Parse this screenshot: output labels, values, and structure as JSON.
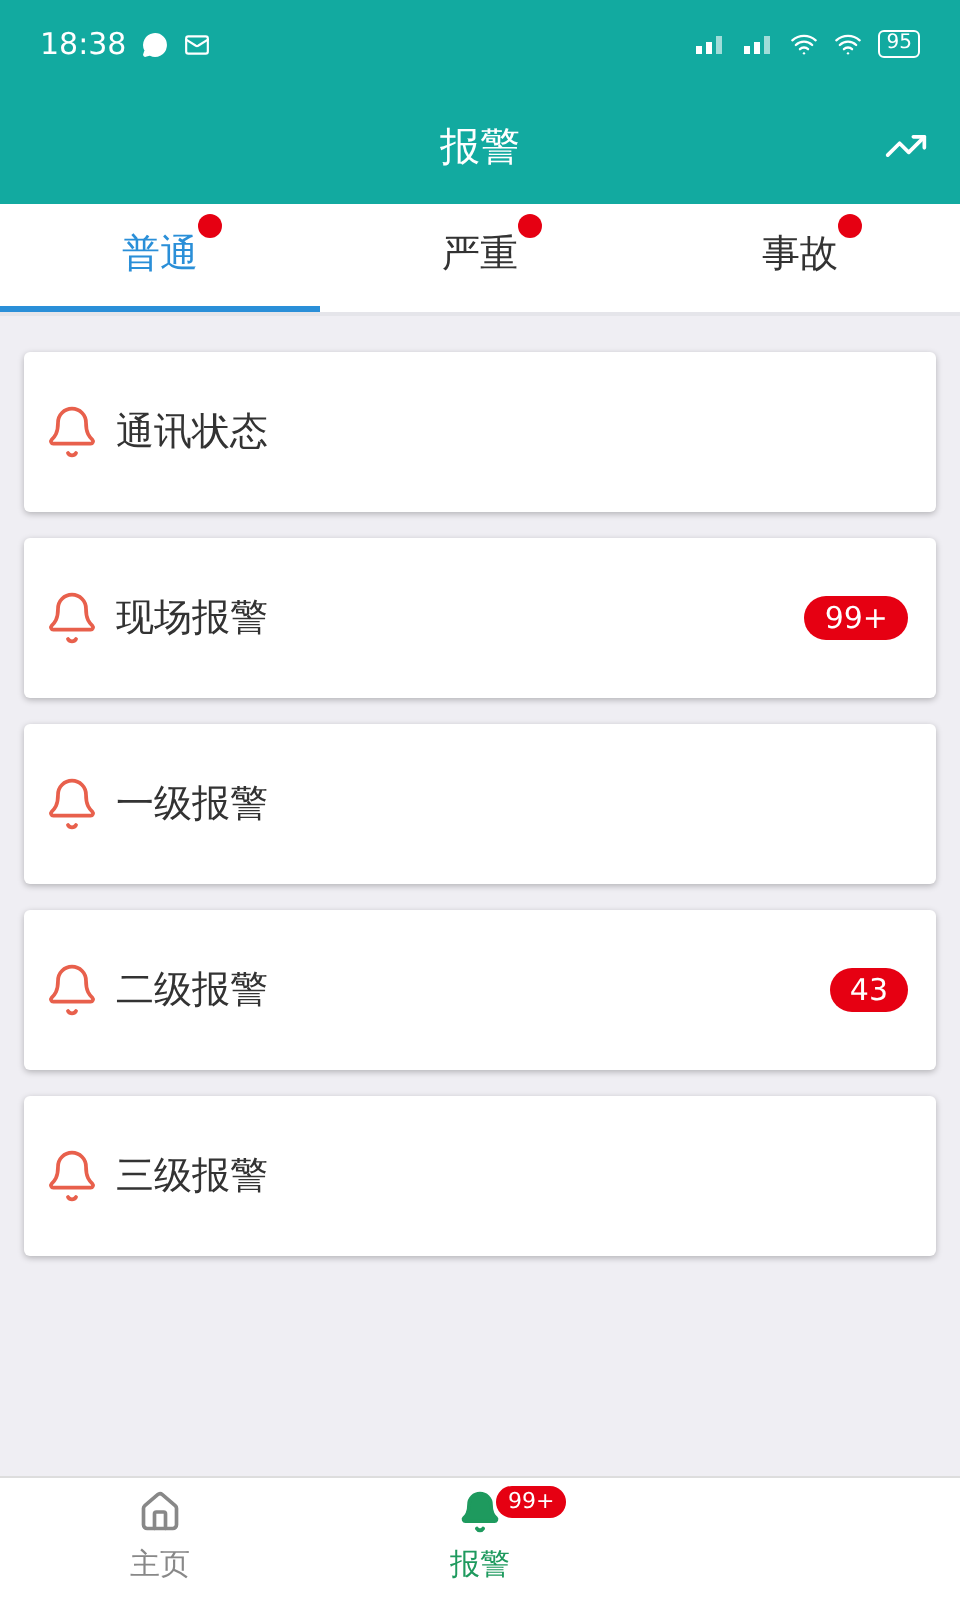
{
  "status_bar": {
    "time": "18:38",
    "battery": "95"
  },
  "header": {
    "title": "报警"
  },
  "tabs": [
    {
      "label": "普通",
      "selected": true,
      "dot": true
    },
    {
      "label": "严重",
      "selected": false,
      "dot": true
    },
    {
      "label": "事故",
      "selected": false,
      "dot": true
    }
  ],
  "alarms": [
    {
      "label": "通讯状态"
    },
    {
      "label": "现场报警",
      "badge": "99+"
    },
    {
      "label": "一级报警"
    },
    {
      "label": "二级报警",
      "badge": "43"
    },
    {
      "label": "三级报警"
    }
  ],
  "bottom_nav": [
    {
      "label": "主页",
      "kind": "home",
      "selected": false
    },
    {
      "label": "报警",
      "kind": "alarm",
      "selected": true,
      "badge": "99+"
    }
  ]
}
